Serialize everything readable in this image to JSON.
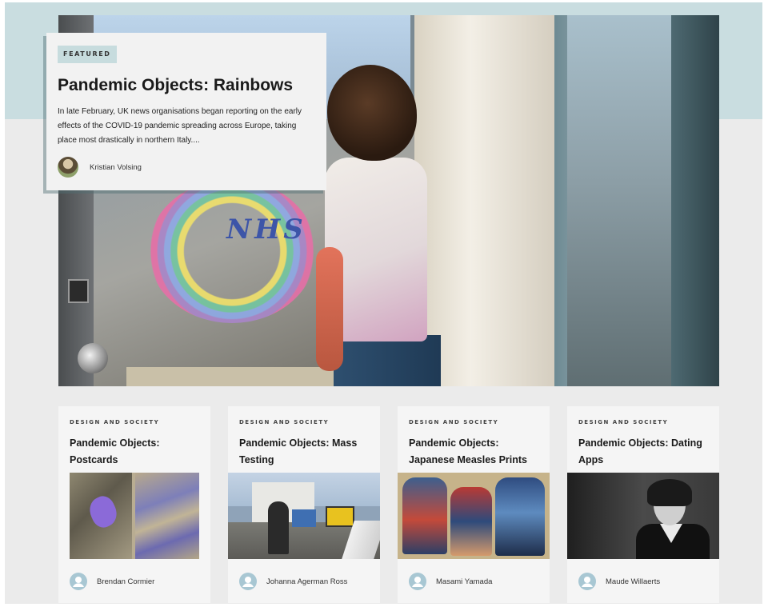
{
  "featured": {
    "badge": "FEATURED",
    "title": "Pandemic Objects: Rainbows",
    "summary": "In late February, UK news organisations began reporting on the early effects of the COVID-19 pandemic spreading across Europe, taking place most drastically in northern Italy....",
    "author": "Kristian Volsing",
    "hero_painting_text": "NHS"
  },
  "articles": [
    {
      "category": "DESIGN AND SOCIETY",
      "title": "Pandemic Objects: Postcards",
      "author": "Brendan Cormier"
    },
    {
      "category": "DESIGN AND SOCIETY",
      "title": "Pandemic Objects: Mass Testing",
      "author": "Johanna Agerman Ross",
      "thumb_sign": ""
    },
    {
      "category": "DESIGN AND SOCIETY",
      "title": "Pandemic Objects: Japanese Measles Prints",
      "author": "Masami Yamada"
    },
    {
      "category": "DESIGN AND SOCIETY",
      "title": "Pandemic Objects: Dating Apps",
      "author": "Maude Willaerts"
    }
  ],
  "colors": {
    "band": "#c9dde0",
    "badge": "#c7dcde",
    "avatar": "#a8c7d3"
  }
}
